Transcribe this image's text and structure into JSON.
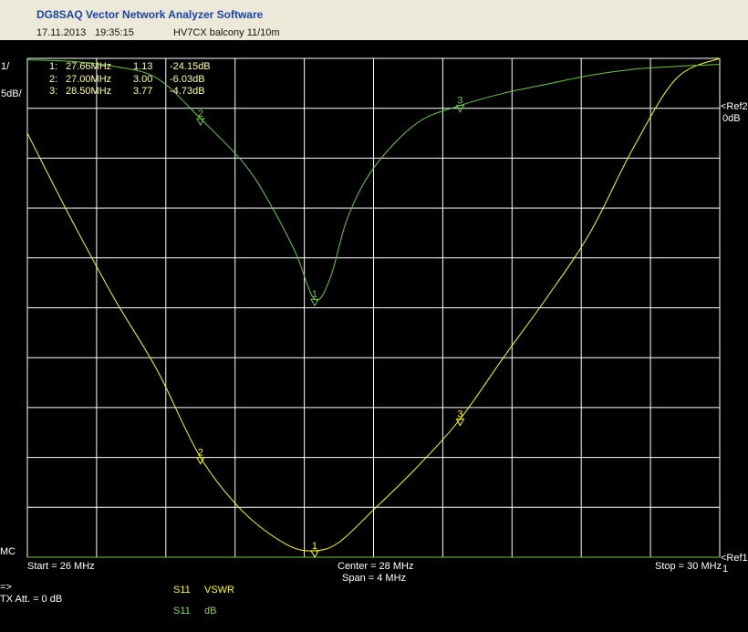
{
  "app": {
    "title": "DG8SAQ Vector Network Analyzer Software",
    "date": "17.11.2013",
    "time": "19:35:15",
    "caption": "HV7CX balcony 11/10m"
  },
  "colors": {
    "background": "#000000",
    "grid": "#ffffff",
    "vswr_trace": "#ffff00",
    "db_trace": "#66cc44",
    "marker_text": "#ffffa0"
  },
  "chart_data": {
    "type": "line",
    "xlim": [
      26,
      30
    ],
    "x_unit": "MHz",
    "grid": true,
    "y_scale_labels": [
      "1/",
      "5dB/"
    ],
    "ref_labels": {
      "ref2": "<Ref2",
      "ref2_value": "0dB",
      "ref1": "<Ref1",
      "ref1_value": "1",
      "mc": "MC"
    },
    "axis_texts": {
      "start": "Start = 26 MHz",
      "center": "Center = 28 MHz",
      "span": "Span = 4 MHz",
      "stop": "Stop = 30 MHz"
    },
    "series": [
      {
        "name": "S11 VSWR",
        "trace": "S11",
        "format": "VSWR",
        "color": "#ffff00",
        "ylim": [
          1,
          11
        ],
        "points": [
          [
            26.0,
            9.5
          ],
          [
            26.25,
            7.8
          ],
          [
            26.5,
            6.2
          ],
          [
            26.75,
            4.75
          ],
          [
            27.0,
            3.0
          ],
          [
            27.25,
            1.9
          ],
          [
            27.5,
            1.25
          ],
          [
            27.66,
            1.13
          ],
          [
            27.8,
            1.3
          ],
          [
            28.0,
            1.95
          ],
          [
            28.25,
            2.8
          ],
          [
            28.5,
            3.77
          ],
          [
            28.75,
            5.0
          ],
          [
            29.0,
            6.2
          ],
          [
            29.25,
            7.5
          ],
          [
            29.5,
            9.2
          ],
          [
            29.75,
            10.6
          ],
          [
            30.0,
            11.0
          ]
        ]
      },
      {
        "name": "S11 dB",
        "trace": "S11",
        "format": "dB",
        "color": "#66cc44",
        "ylim": [
          -50,
          0
        ],
        "points": [
          [
            26.0,
            -0.15
          ],
          [
            26.25,
            -0.3
          ],
          [
            26.5,
            -0.8
          ],
          [
            26.75,
            -2.0
          ],
          [
            27.0,
            -6.03
          ],
          [
            27.25,
            -10.5
          ],
          [
            27.4,
            -14.5
          ],
          [
            27.55,
            -19.5
          ],
          [
            27.66,
            -24.15
          ],
          [
            27.75,
            -22.0
          ],
          [
            27.85,
            -16.0
          ],
          [
            28.0,
            -11.0
          ],
          [
            28.25,
            -6.5
          ],
          [
            28.5,
            -4.73
          ],
          [
            28.75,
            -3.5
          ],
          [
            29.0,
            -2.6
          ],
          [
            29.25,
            -1.7
          ],
          [
            29.5,
            -1.1
          ],
          [
            29.75,
            -0.8
          ],
          [
            30.0,
            -0.6
          ]
        ]
      }
    ],
    "markers": [
      {
        "id": "1",
        "freq_label": "27.66MHz",
        "vswr_label": "1.13",
        "db_label": "-24.15dB",
        "freq": 27.66,
        "vswr": 1.13,
        "db": -24.15
      },
      {
        "id": "2",
        "freq_label": "27.00MHz",
        "vswr_label": "3.00",
        "db_label": "-6.03dB",
        "freq": 27.0,
        "vswr": 3.0,
        "db": -6.03
      },
      {
        "id": "3",
        "freq_label": "28.50MHz",
        "vswr_label": "3.77",
        "db_label": "-4.73dB",
        "freq": 28.5,
        "vswr": 3.77,
        "db": -4.73
      }
    ]
  },
  "footer": {
    "arrow": "=>",
    "tx_att": "TX Att. = 0 dB",
    "legend": [
      {
        "trace": "S11",
        "format": "VSWR"
      },
      {
        "trace": "S11",
        "format": "dB"
      }
    ]
  }
}
